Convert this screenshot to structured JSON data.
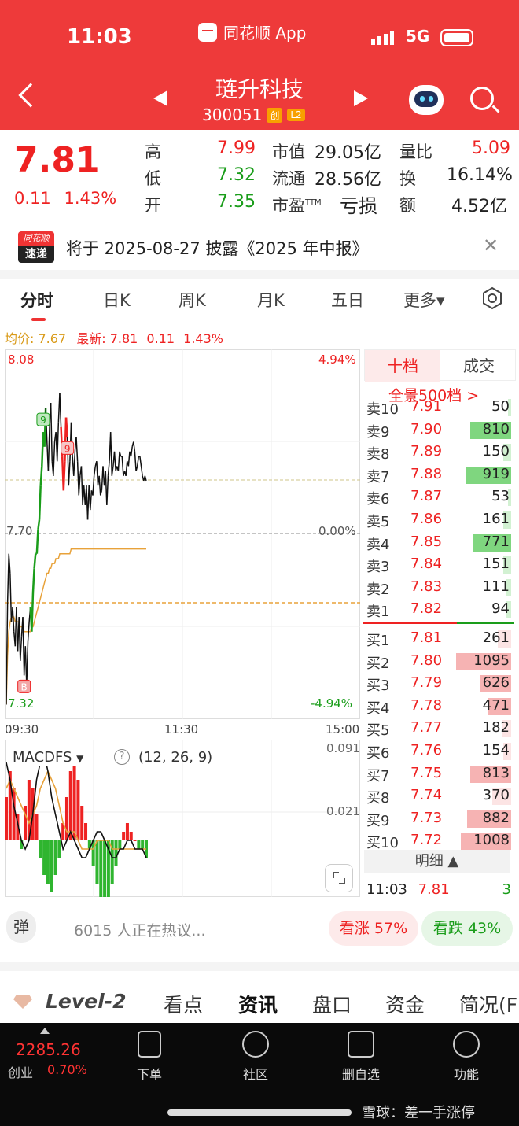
{
  "status": {
    "time": "11:03",
    "app": "同花顺 App",
    "network": "5G"
  },
  "header": {
    "name": "琏升科技",
    "code": "300051",
    "badge1": "创",
    "badge2": "L2"
  },
  "quote": {
    "price": "7.81",
    "change": "0.11",
    "change_pct": "1.43%",
    "high_label": "高",
    "high": "7.99",
    "low_label": "低",
    "low": "7.32",
    "open_label": "开",
    "open": "7.35",
    "mcap_label": "市值",
    "mcap": "29.05亿",
    "float_label": "流通",
    "float": "28.56亿",
    "pe_label": "市盈",
    "pe_sup": "TTM",
    "pe": "亏损",
    "vr_label": "量比",
    "vr": "5.09",
    "turn_label": "换",
    "turn": "16.14%",
    "amt_label": "额",
    "amt": "4.52亿"
  },
  "notice": {
    "logo_top": "同花顺",
    "logo_bottom": "速递",
    "text": "将于 2025-08-27 披露《2025 年中报》"
  },
  "tabs": [
    "分时",
    "日K",
    "周K",
    "月K",
    "五日",
    "更多▾"
  ],
  "chart_data": {
    "type": "line",
    "title": "",
    "info": {
      "avg_label": "均价: 7.67",
      "latest_label": "最新:",
      "latest": "7.81",
      "chg": "0.11",
      "pct": "1.43%"
    },
    "y_left": [
      "8.08",
      "7.70",
      "7.32"
    ],
    "y_right": [
      "4.94%",
      "0.00%",
      "-4.94%"
    ],
    "x_ticks": [
      "09:30",
      "11:30",
      "15:00"
    ],
    "ylim": [
      7.32,
      8.08
    ],
    "price": [
      7.35,
      7.56,
      7.66,
      7.62,
      7.52,
      7.55,
      7.5,
      7.47,
      7.55,
      7.46,
      7.53,
      7.44,
      7.49,
      7.53,
      7.41,
      7.47,
      7.39,
      7.48,
      7.52,
      7.55,
      7.5,
      7.58,
      7.63,
      7.66,
      7.66,
      7.71,
      7.73,
      7.8,
      7.84,
      7.91,
      7.88,
      7.96,
      7.89,
      7.83,
      7.92,
      7.97,
      7.85,
      7.82,
      7.89,
      7.91,
      7.85,
      7.93,
      7.99,
      7.92,
      7.86,
      7.79,
      7.85,
      7.94,
      7.9,
      7.8,
      7.85,
      7.93,
      7.86,
      7.82,
      7.87,
      7.9,
      7.85,
      7.78,
      7.82,
      7.84,
      7.76,
      7.8,
      7.76,
      7.8,
      7.73,
      7.8,
      7.75,
      7.79,
      7.78,
      7.82,
      7.84,
      7.85,
      7.8,
      7.82,
      7.78,
      7.79,
      7.84,
      7.8,
      7.83,
      7.76,
      7.82,
      7.85,
      7.91,
      7.82,
      7.84,
      7.87,
      7.83,
      7.84,
      7.83,
      7.87,
      7.86,
      7.86,
      7.82,
      7.83,
      7.82,
      7.85,
      7.84,
      7.87,
      7.86,
      7.88,
      7.89,
      7.87,
      7.83,
      7.84,
      7.86,
      7.86,
      7.84,
      7.82,
      7.81,
      7.82,
      7.81
    ],
    "avg": [
      7.35,
      7.45,
      7.5,
      7.52,
      7.53,
      7.53,
      7.53,
      7.52,
      7.52,
      7.52,
      7.52,
      7.51,
      7.51,
      7.51,
      7.5,
      7.5,
      7.5,
      7.5,
      7.5,
      7.5,
      7.51,
      7.51,
      7.52,
      7.53,
      7.54,
      7.55,
      7.56,
      7.57,
      7.58,
      7.59,
      7.6,
      7.61,
      7.62,
      7.62,
      7.63,
      7.63,
      7.64,
      7.64,
      7.64,
      7.65,
      7.65,
      7.65,
      7.66,
      7.66,
      7.66,
      7.66,
      7.66,
      7.66,
      7.66,
      7.66,
      7.66,
      7.67,
      7.67,
      7.67,
      7.67,
      7.67,
      7.67,
      7.67,
      7.67,
      7.67,
      7.67,
      7.67,
      7.67,
      7.67,
      7.67,
      7.67,
      7.67,
      7.67,
      7.67,
      7.67,
      7.67,
      7.67,
      7.67,
      7.67,
      7.67,
      7.67,
      7.67,
      7.67,
      7.67,
      7.67,
      7.67,
      7.67,
      7.67,
      7.67,
      7.67,
      7.67,
      7.67,
      7.67,
      7.67,
      7.67,
      7.67,
      7.67,
      7.67,
      7.67,
      7.67,
      7.67,
      7.67,
      7.67,
      7.67,
      7.67,
      7.67,
      7.67,
      7.67,
      7.67,
      7.67,
      7.67,
      7.67,
      7.67,
      7.67,
      7.67,
      7.67
    ],
    "markers": [
      {
        "label": "B",
        "at": 14
      },
      {
        "label": "9",
        "at": 29
      },
      {
        "label": "9",
        "at": 48
      }
    ],
    "macd": {
      "name": "MACDFS",
      "params": "(12, 26, 9)",
      "ticks": [
        "0.091",
        "0.021"
      ],
      "hist": [
        0.05,
        0.08,
        0.06,
        0.03,
        -0.01,
        0.04,
        0.07,
        0.06,
        0.03,
        -0.02,
        -0.04,
        -0.05,
        -0.06,
        -0.04,
        -0.02,
        0.02,
        0.05,
        0.08,
        0.09,
        0.07,
        0.04,
        0.02,
        -0.01,
        -0.03,
        -0.05,
        -0.07,
        -0.08,
        -0.07,
        -0.05,
        -0.03,
        -0.01,
        0.01,
        0.02,
        0.01,
        0.0,
        -0.01,
        -0.01,
        -0.02
      ],
      "dif": [
        0.09,
        0.07,
        0.04,
        0.02,
        0.0,
        -0.01,
        0.0,
        0.03,
        0.07,
        0.09,
        0.1,
        0.08,
        0.05,
        0.03,
        0.01,
        -0.01,
        0.0,
        0.01,
        0.0,
        -0.01,
        -0.02,
        -0.02,
        -0.01,
        0.0,
        0.01,
        0.01,
        0.0,
        -0.01,
        -0.02,
        -0.02,
        -0.01,
        -0.01,
        0.0,
        0.0,
        -0.01,
        -0.01,
        -0.01,
        -0.02
      ],
      "dea": [
        0.06,
        0.07,
        0.06,
        0.05,
        0.04,
        0.03,
        0.02,
        0.03,
        0.04,
        0.06,
        0.07,
        0.08,
        0.07,
        0.06,
        0.04,
        0.02,
        0.01,
        0.01,
        0.01,
        0.0,
        -0.01,
        -0.01,
        -0.01,
        -0.01,
        0.0,
        0.0,
        0.0,
        0.0,
        -0.01,
        -0.01,
        -0.01,
        -0.01,
        -0.01,
        -0.01,
        -0.01,
        -0.01,
        -0.01,
        -0.01
      ]
    }
  },
  "orderbook": {
    "tab_active": "十档",
    "tab_other": "成交",
    "depth_link": "全景500档 >",
    "asks": [
      {
        "label": "卖10",
        "price": "7.91",
        "vol": "50"
      },
      {
        "label": "卖9",
        "price": "7.90",
        "vol": "810"
      },
      {
        "label": "卖8",
        "price": "7.89",
        "vol": "150"
      },
      {
        "label": "卖7",
        "price": "7.88",
        "vol": "919"
      },
      {
        "label": "卖6",
        "price": "7.87",
        "vol": "53"
      },
      {
        "label": "卖5",
        "price": "7.86",
        "vol": "161"
      },
      {
        "label": "卖4",
        "price": "7.85",
        "vol": "771"
      },
      {
        "label": "卖3",
        "price": "7.84",
        "vol": "151"
      },
      {
        "label": "卖2",
        "price": "7.83",
        "vol": "111"
      },
      {
        "label": "卖1",
        "price": "7.82",
        "vol": "94"
      }
    ],
    "bids": [
      {
        "label": "买1",
        "price": "7.81",
        "vol": "261"
      },
      {
        "label": "买2",
        "price": "7.80",
        "vol": "1095"
      },
      {
        "label": "买3",
        "price": "7.79",
        "vol": "626"
      },
      {
        "label": "买4",
        "price": "7.78",
        "vol": "471"
      },
      {
        "label": "买5",
        "price": "7.77",
        "vol": "182"
      },
      {
        "label": "买6",
        "price": "7.76",
        "vol": "154"
      },
      {
        "label": "买7",
        "price": "7.75",
        "vol": "813"
      },
      {
        "label": "买8",
        "price": "7.74",
        "vol": "370"
      },
      {
        "label": "买9",
        "price": "7.73",
        "vol": "882"
      },
      {
        "label": "买10",
        "price": "7.72",
        "vol": "1008"
      }
    ],
    "detail_label": "明细 ▲",
    "last_trade": {
      "time": "11:03",
      "price": "7.81",
      "vol": "3"
    },
    "ask_bar_color": "#7fd67f",
    "bid_bar_color": "#f6b3b3"
  },
  "social": {
    "bubble": "弹",
    "text": "6015 人正在热议...",
    "bull": "看涨 57%",
    "bear": "看跌 43%"
  },
  "subtabs": [
    "Level-2",
    "看点",
    "资讯",
    "盘口",
    "资金",
    "简况(F"
  ],
  "index": {
    "value": "2285.26",
    "name": "创业",
    "pct": "0.70%"
  },
  "nav": [
    "下单",
    "社区",
    "删自选",
    "功能"
  ],
  "watermark": "雪球：差一手涨停",
  "colors": {
    "up": "#e22222",
    "down": "#1a9d1a",
    "brand": "#ee3a3a",
    "avg_line": "#e8a23a"
  }
}
